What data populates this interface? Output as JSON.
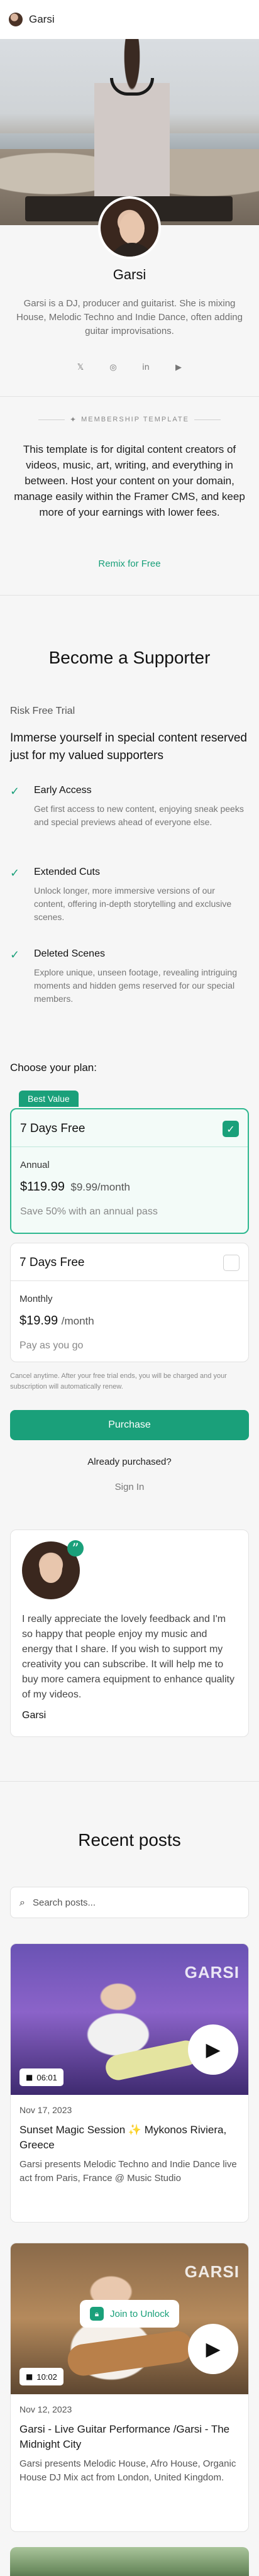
{
  "header": {
    "site_name": "Garsi",
    "avatar_icon": "logo-avatar"
  },
  "profile": {
    "name": "Garsi",
    "bio": "Garsi is a DJ, producer and guitarist. She is mixing House, Melodic Techno and Indie Dance, often adding guitar improvisations.",
    "socials": [
      {
        "icon": "x-icon",
        "glyph": "𝕏"
      },
      {
        "icon": "instagram-icon",
        "glyph": "◎"
      },
      {
        "icon": "linkedin-icon",
        "glyph": "in"
      },
      {
        "icon": "youtube-icon",
        "glyph": "▶"
      }
    ]
  },
  "template_badge": {
    "label": "MEMBERSHIP TEMPLATE",
    "icon": "puzzle-icon",
    "glyph": "✦"
  },
  "template_copy": "This template is for digital content creators of videos, music, art, writing, and everything in between. Host your content on your domain, manage easily within the Framer CMS, and keep more of your earnings with lower fees.",
  "remix_label": "Remix for Free",
  "supporter": {
    "title": "Become a Supporter",
    "risk_free": "Risk Free Trial",
    "headline": "Immerse yourself in special content reserved just for my valued supporters",
    "features": [
      {
        "title": "Early Access",
        "desc": "Get first access to new content, enjoying sneak peeks and special previews ahead of everyone else."
      },
      {
        "title": "Extended Cuts",
        "desc": "Unlock longer, more immersive versions of our content, offering in-depth storytelling and exclusive scenes."
      },
      {
        "title": "Deleted Scenes",
        "desc": "Explore unique, unseen footage, revealing intriguing moments and hidden gems reserved for our special members."
      }
    ],
    "choose_label": "Choose your plan:",
    "best_value": "Best Value",
    "plans": [
      {
        "title": "7 Days Free",
        "period": "Annual",
        "price": "$119.99",
        "strike": "$9.99",
        "per": "/month",
        "note": "Save 50% with an annual pass",
        "selected": true
      },
      {
        "title": "7 Days Free",
        "period": "Monthly",
        "price": "$19.99",
        "strike": "",
        "per": "/month",
        "note": "Pay as you go",
        "selected": false
      }
    ],
    "cancel_note": "Cancel anytime. After your free trial ends, you will be charged and your subscription will automatically renew.",
    "purchase_label": "Purchase",
    "already_label": "Already purchased?",
    "signin_label": "Sign In"
  },
  "testimonial": {
    "text": "I really appreciate the lovely feedback and I'm so happy that people enjoy my music and energy that I share. If you wish to support my creativity you can subscribe. It will help me to buy more camera equipment to enhance quality of my videos.",
    "name": "Garsi",
    "quote_glyph": "”"
  },
  "recent": {
    "title": "Recent posts",
    "search_placeholder": "Search posts...",
    "posts": [
      {
        "brand": "GARSI",
        "duration": "06:01",
        "date": "Nov 17, 2023",
        "title": "Sunset Magic Session ✨ Mykonos Riviera, Greece",
        "desc": "Garsi presents  Melodic Techno  and Indie Dance live act from Paris, France @ Music Studio",
        "locked": false
      },
      {
        "brand": "GARSI",
        "duration": "10:02",
        "date": "Nov 12, 2023",
        "title": "Garsi - Live Guitar Performance /Garsi - The Midnight City",
        "desc": "Garsi presents Melodic House, Afro House, Organic House DJ Mix act from London, United Kingdom.",
        "locked": true,
        "join_label": "Join to Unlock"
      }
    ]
  },
  "colors": {
    "accent": "#1aa07a",
    "background": "#f6f6f6"
  }
}
